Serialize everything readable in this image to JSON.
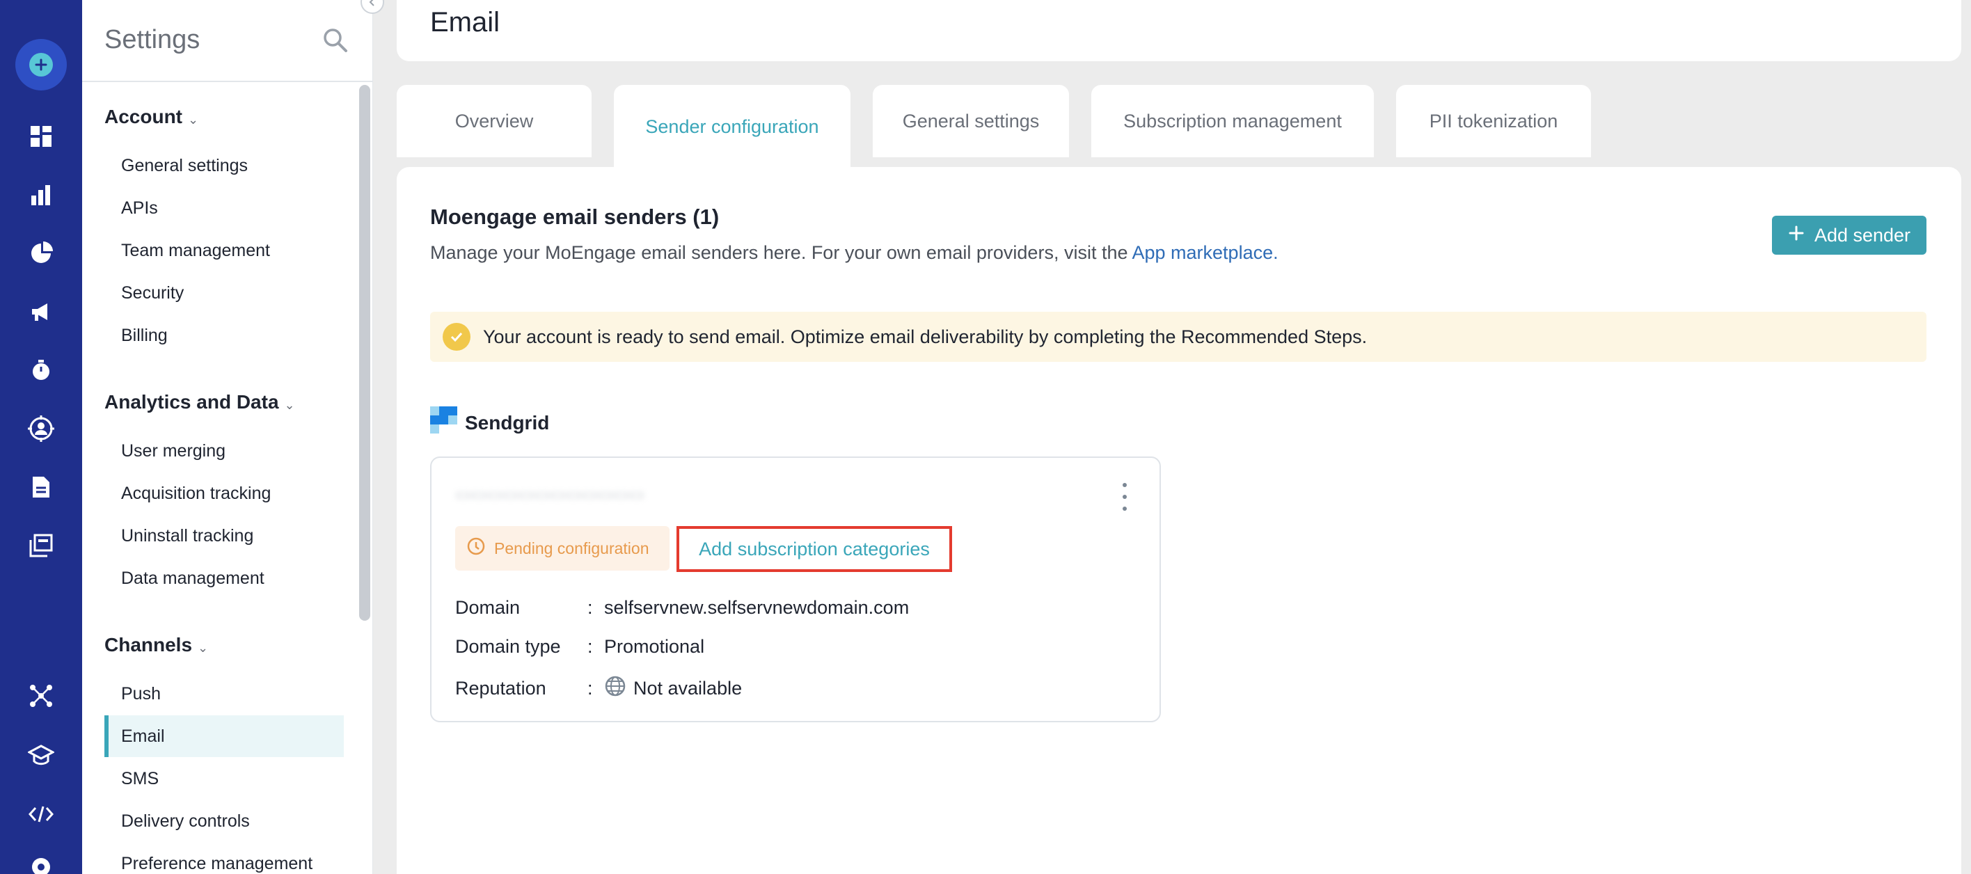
{
  "settings": {
    "title": "Settings",
    "groups": [
      {
        "title": "Account",
        "items": [
          "General settings",
          "APIs",
          "Team management",
          "Security",
          "Billing"
        ]
      },
      {
        "title": "Analytics and Data",
        "items": [
          "User merging",
          "Acquisition tracking",
          "Uninstall tracking",
          "Data management"
        ]
      },
      {
        "title": "Channels",
        "items": [
          "Push",
          "Email",
          "SMS",
          "Delivery controls",
          "Preference management"
        ]
      }
    ]
  },
  "page": {
    "title": "Email",
    "tabs": [
      "Overview",
      "Sender configuration",
      "General settings",
      "Subscription management",
      "PII tokenization"
    ],
    "active_tab": "Sender configuration"
  },
  "section": {
    "title": "Moengage email senders (1)",
    "description": "Manage your MoEngage email senders here. For your own email providers, visit the ",
    "link_text": "App marketplace.",
    "add_sender_label": "Add sender"
  },
  "banner": {
    "text": "Your account is ready to send email. Optimize email deliverability by completing the Recommended Steps."
  },
  "provider": {
    "name": "Sendgrid"
  },
  "sender": {
    "status": "Pending configuration",
    "action": "Add subscription categories",
    "fields": [
      {
        "label": "Domain",
        "value": "selfservnew.selfservnewdomain.com"
      },
      {
        "label": "Domain type",
        "value": "Promotional"
      },
      {
        "label": "Reputation",
        "value": "Not available"
      }
    ]
  },
  "colors": {
    "rail": "#1f2f8c",
    "accent": "#3aa6b9",
    "highlight": "#e43b2f"
  }
}
